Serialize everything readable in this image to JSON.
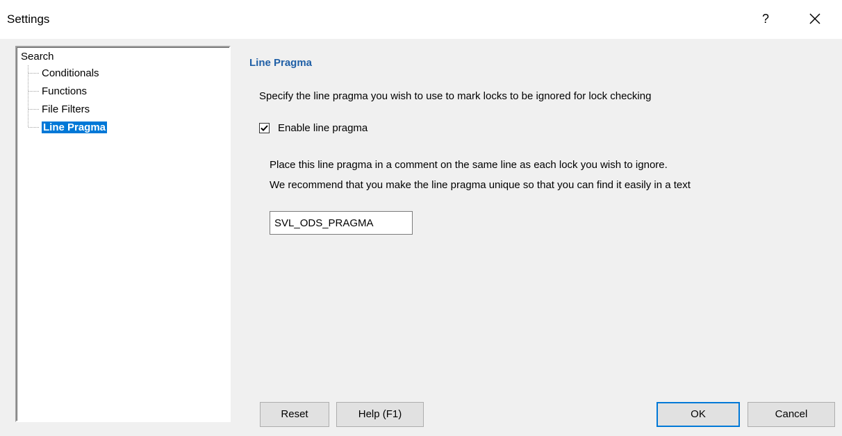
{
  "window": {
    "title": "Settings",
    "help_glyph": "?",
    "close_icon": "close-icon"
  },
  "tree": {
    "root": "Search",
    "items": [
      {
        "label": "Conditionals",
        "selected": false
      },
      {
        "label": "Functions",
        "selected": false
      },
      {
        "label": "File Filters",
        "selected": false
      },
      {
        "label": "Line Pragma",
        "selected": true
      }
    ]
  },
  "panel": {
    "title": "Line Pragma",
    "description": "Specify the line pragma you wish to use to mark locks to be ignored for lock checking",
    "checkbox": {
      "label": "Enable line pragma",
      "checked": true
    },
    "hint_line1": "Place this line pragma in a comment on the same line as each lock you wish to ignore.",
    "hint_line2": "We recommend that you make the line pragma unique so that you can find it easily in a text",
    "pragma_value": "SVL_ODS_PRAGMA"
  },
  "buttons": {
    "reset": "Reset",
    "help": "Help (F1)",
    "ok": "OK",
    "cancel": "Cancel"
  },
  "colors": {
    "accent": "#0078d7",
    "section_title": "#1f5fa6"
  }
}
